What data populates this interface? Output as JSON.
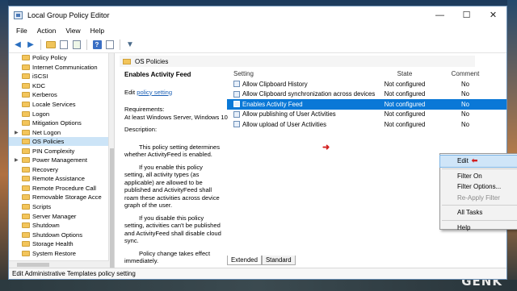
{
  "window": {
    "title": "Local Group Policy Editor",
    "controls": {
      "minimize": "—",
      "maximize": "☐",
      "close": "✕"
    }
  },
  "menubar": [
    "File",
    "Action",
    "View",
    "Help"
  ],
  "toolbar": {
    "icons": [
      "back-arrow-icon",
      "forward-arrow-icon",
      "folder-up-icon",
      "show-hide-tree-icon",
      "export-list-icon",
      "help-icon",
      "properties-icon",
      "filter-icon"
    ]
  },
  "tree": {
    "items": [
      {
        "label": "Policy Policy"
      },
      {
        "label": "Internet Communication"
      },
      {
        "label": "iSCSI"
      },
      {
        "label": "KDC"
      },
      {
        "label": "Kerberos"
      },
      {
        "label": "Locale Services"
      },
      {
        "label": "Logon"
      },
      {
        "label": "Mitigation Options"
      },
      {
        "label": "Net Logon",
        "expandable": true
      },
      {
        "label": "OS Policies",
        "selected": true
      },
      {
        "label": "PIN Complexity"
      },
      {
        "label": "Power Management",
        "expandable": true
      },
      {
        "label": "Recovery"
      },
      {
        "label": "Remote Assistance"
      },
      {
        "label": "Remote Procedure Call"
      },
      {
        "label": "Removable Storage Acce"
      },
      {
        "label": "Scripts"
      },
      {
        "label": "Server Manager"
      },
      {
        "label": "Shutdown"
      },
      {
        "label": "Shutdown Options"
      },
      {
        "label": "Storage Health"
      },
      {
        "label": "System Restore"
      }
    ]
  },
  "extended_header": "OS Policies",
  "description": {
    "heading": "Enables Activity Feed",
    "edit_prefix": "Edit",
    "edit_link": "policy setting",
    "requirements_label": "Requirements:",
    "requirements_value": "At least Windows Server, Windows 10",
    "description_label": "Description:",
    "paragraphs": [
      "This policy setting determines whether ActivityFeed is enabled.",
      "If you enable this policy setting, all activity types (as applicable) are allowed to be published and ActivityFeed shall roam these activities across device graph of the user.",
      "If you disable this policy setting, activities can't be published and ActivityFeed shall disable cloud sync.",
      "Policy change takes effect immediately."
    ]
  },
  "settings_list": {
    "columns": {
      "setting": "Setting",
      "state": "State",
      "comment": "Comment"
    },
    "rows": [
      {
        "setting": "Allow Clipboard History",
        "state": "Not configured",
        "comment": "No"
      },
      {
        "setting": "Allow Clipboard synchronization across devices",
        "state": "Not configured",
        "comment": "No"
      },
      {
        "setting": "Enables Activity Feed",
        "state": "Not configured",
        "comment": "No",
        "selected": true
      },
      {
        "setting": "Allow publishing of User Activities",
        "state": "Not configured",
        "comment": "No"
      },
      {
        "setting": "Allow upload of User Activities",
        "state": "Not configured",
        "comment": "No"
      }
    ]
  },
  "context_menu": {
    "items": [
      {
        "label": "Edit",
        "hover": true
      },
      {
        "separator": true
      },
      {
        "label": "Filter On"
      },
      {
        "label": "Filter Options..."
      },
      {
        "label": "Re-Apply Filter",
        "disabled": true
      },
      {
        "separator": true
      },
      {
        "label": "All Tasks",
        "submenu": true
      },
      {
        "separator": true
      },
      {
        "label": "Help"
      }
    ]
  },
  "tabs": [
    "Extended",
    "Standard"
  ],
  "statusbar": "Edit Administrative Templates policy setting",
  "watermark": "GENK",
  "colors": {
    "selection": "#0a78d7",
    "tree_selection": "#cce4f7",
    "annotation_arrow": "#d21f1f"
  }
}
